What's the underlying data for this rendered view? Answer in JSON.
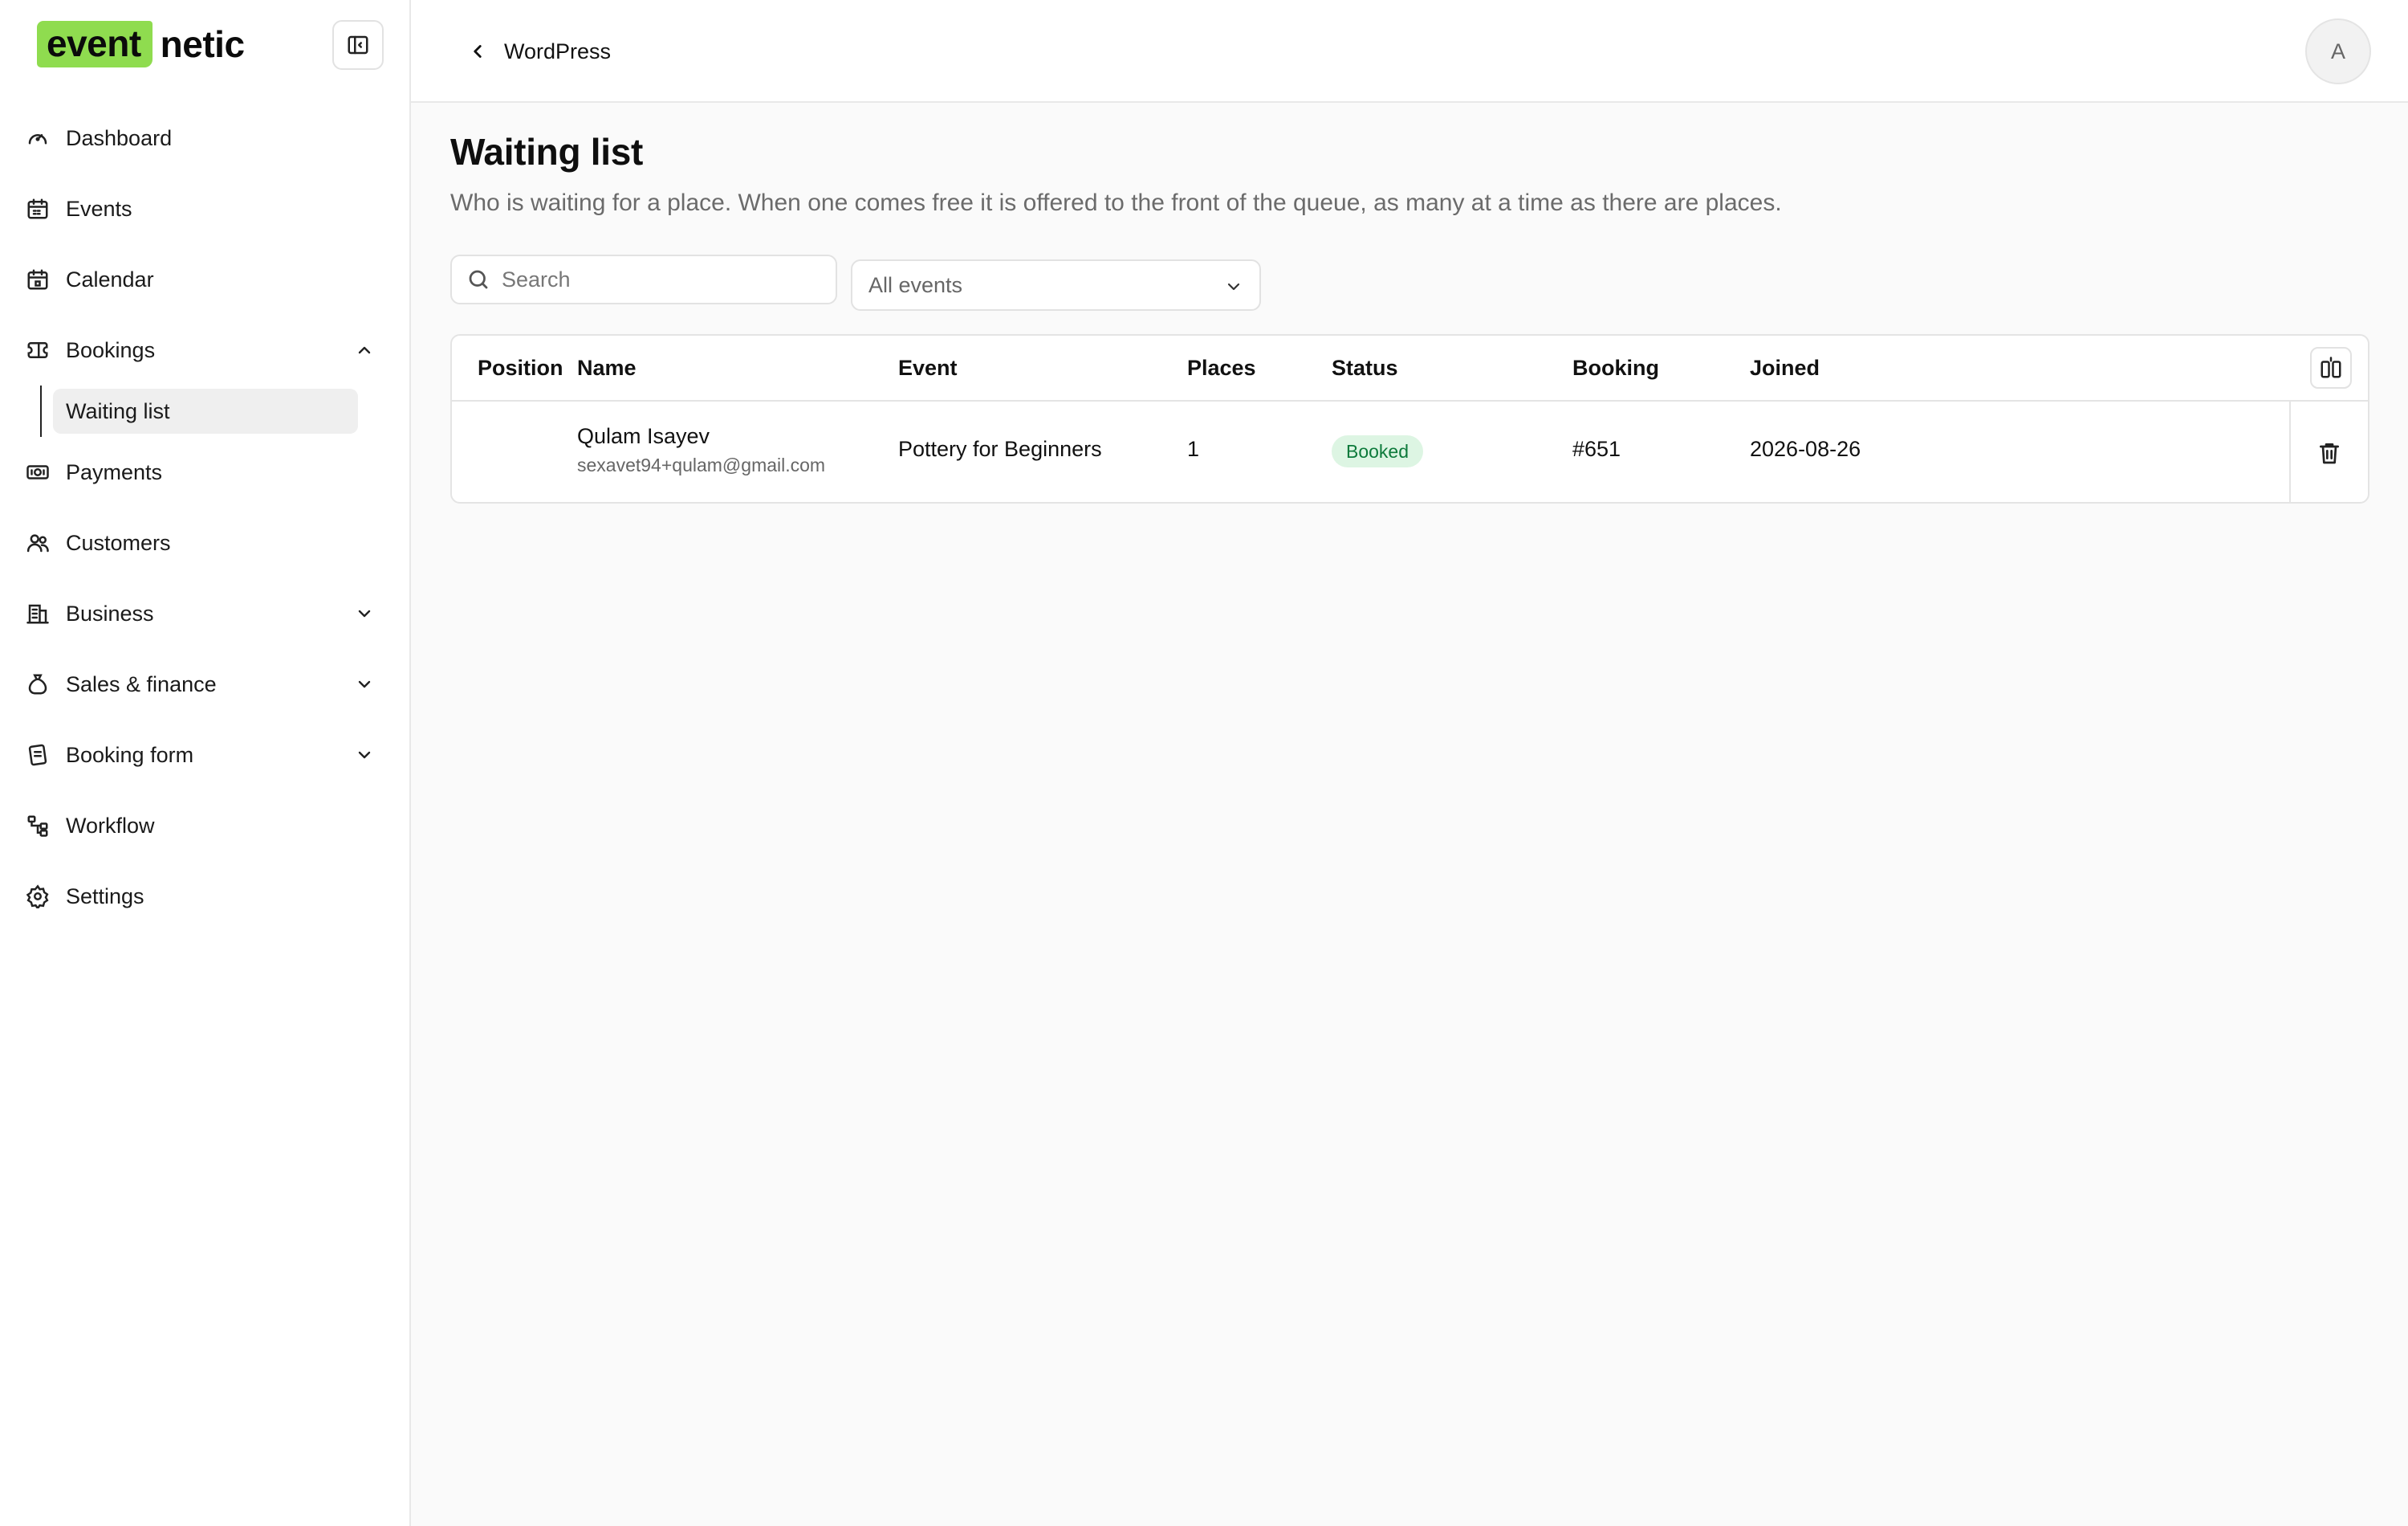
{
  "brand": {
    "mark": "event",
    "rest": "netic",
    "accent": "#8fdc4f"
  },
  "sidebar": {
    "items": [
      {
        "label": "Dashboard",
        "icon": "gauge-icon"
      },
      {
        "label": "Events",
        "icon": "calendar-icon"
      },
      {
        "label": "Calendar",
        "icon": "calendar-grid-icon"
      },
      {
        "label": "Bookings",
        "icon": "ticket-icon",
        "expanded": true,
        "children": [
          {
            "label": "Waiting list",
            "active": true
          }
        ]
      },
      {
        "label": "Payments",
        "icon": "banknote-icon"
      },
      {
        "label": "Customers",
        "icon": "users-icon"
      },
      {
        "label": "Business",
        "icon": "building-icon",
        "expanded": false
      },
      {
        "label": "Sales & finance",
        "icon": "money-bag-icon",
        "expanded": false
      },
      {
        "label": "Booking form",
        "icon": "form-icon",
        "expanded": false
      },
      {
        "label": "Workflow",
        "icon": "workflow-icon"
      },
      {
        "label": "Settings",
        "icon": "gear-icon"
      }
    ]
  },
  "topbar": {
    "back_label": "WordPress",
    "avatar_initial": "A"
  },
  "page": {
    "title": "Waiting list",
    "description": "Who is waiting for a place. When one comes free it is offered to the front of the queue, as many at a time as there are places."
  },
  "filters": {
    "search_placeholder": "Search",
    "event_select": "All events"
  },
  "table": {
    "columns": [
      "Position",
      "Name",
      "Event",
      "Places",
      "Status",
      "Booking",
      "Joined"
    ],
    "rows": [
      {
        "position": "",
        "name": "Qulam Isayev",
        "email": "sexavet94+qulam@gmail.com",
        "event": "Pottery for Beginners",
        "places": "1",
        "status": "Booked",
        "booking": "#651",
        "joined": "2026-08-26"
      }
    ]
  },
  "colors": {
    "status_booked_bg": "#ddf5e3",
    "status_booked_fg": "#0d7a3b"
  }
}
